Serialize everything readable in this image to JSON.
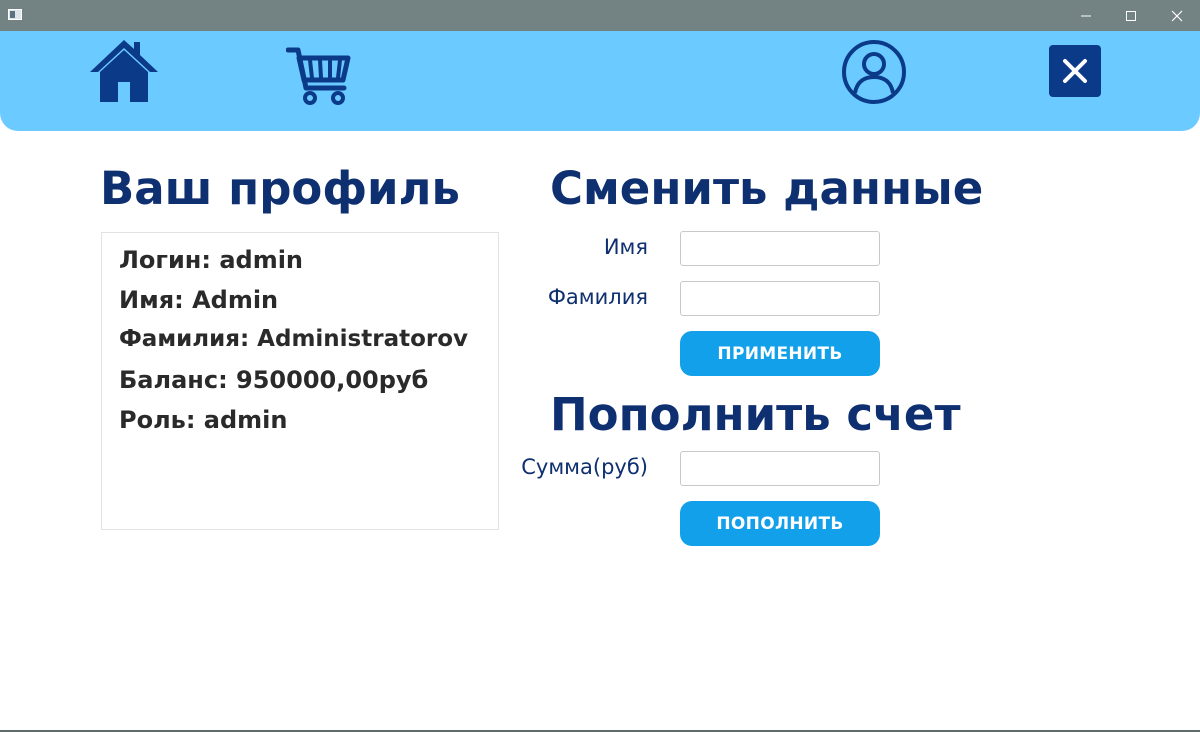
{
  "window": {
    "icons": {
      "app": "app-window-icon",
      "minimize": "minimize-icon",
      "maximize": "maximize-icon",
      "close": "close-icon"
    }
  },
  "navbar": {
    "background": "#6bcaff",
    "icon_color": "#0b3a88",
    "icons": {
      "home": "home-icon",
      "cart": "shopping-cart-icon",
      "profile": "user-circle-icon",
      "exit": "close-x-icon"
    }
  },
  "profile": {
    "heading": "Ваш профиль",
    "login": "Логин: admin",
    "name": "Имя: Admin",
    "surname": "Фамилия: Administratorov",
    "balance": "Баланс: 950000,00руб",
    "role": "Роль: admin"
  },
  "change_data": {
    "heading": "Сменить данные",
    "name_label": "Имя",
    "name_value": "",
    "surname_label": "Фамилия",
    "surname_value": "",
    "apply_label": "ПРИМЕНИТЬ"
  },
  "top_up": {
    "heading": "Пополнить счет",
    "sum_label": "Сумма(руб)",
    "sum_value": "",
    "submit_label": "ПОПОЛНИТЬ"
  },
  "colors": {
    "heading": "#0e2f70",
    "button": "#13a0ea",
    "titlebar": "#738282"
  }
}
